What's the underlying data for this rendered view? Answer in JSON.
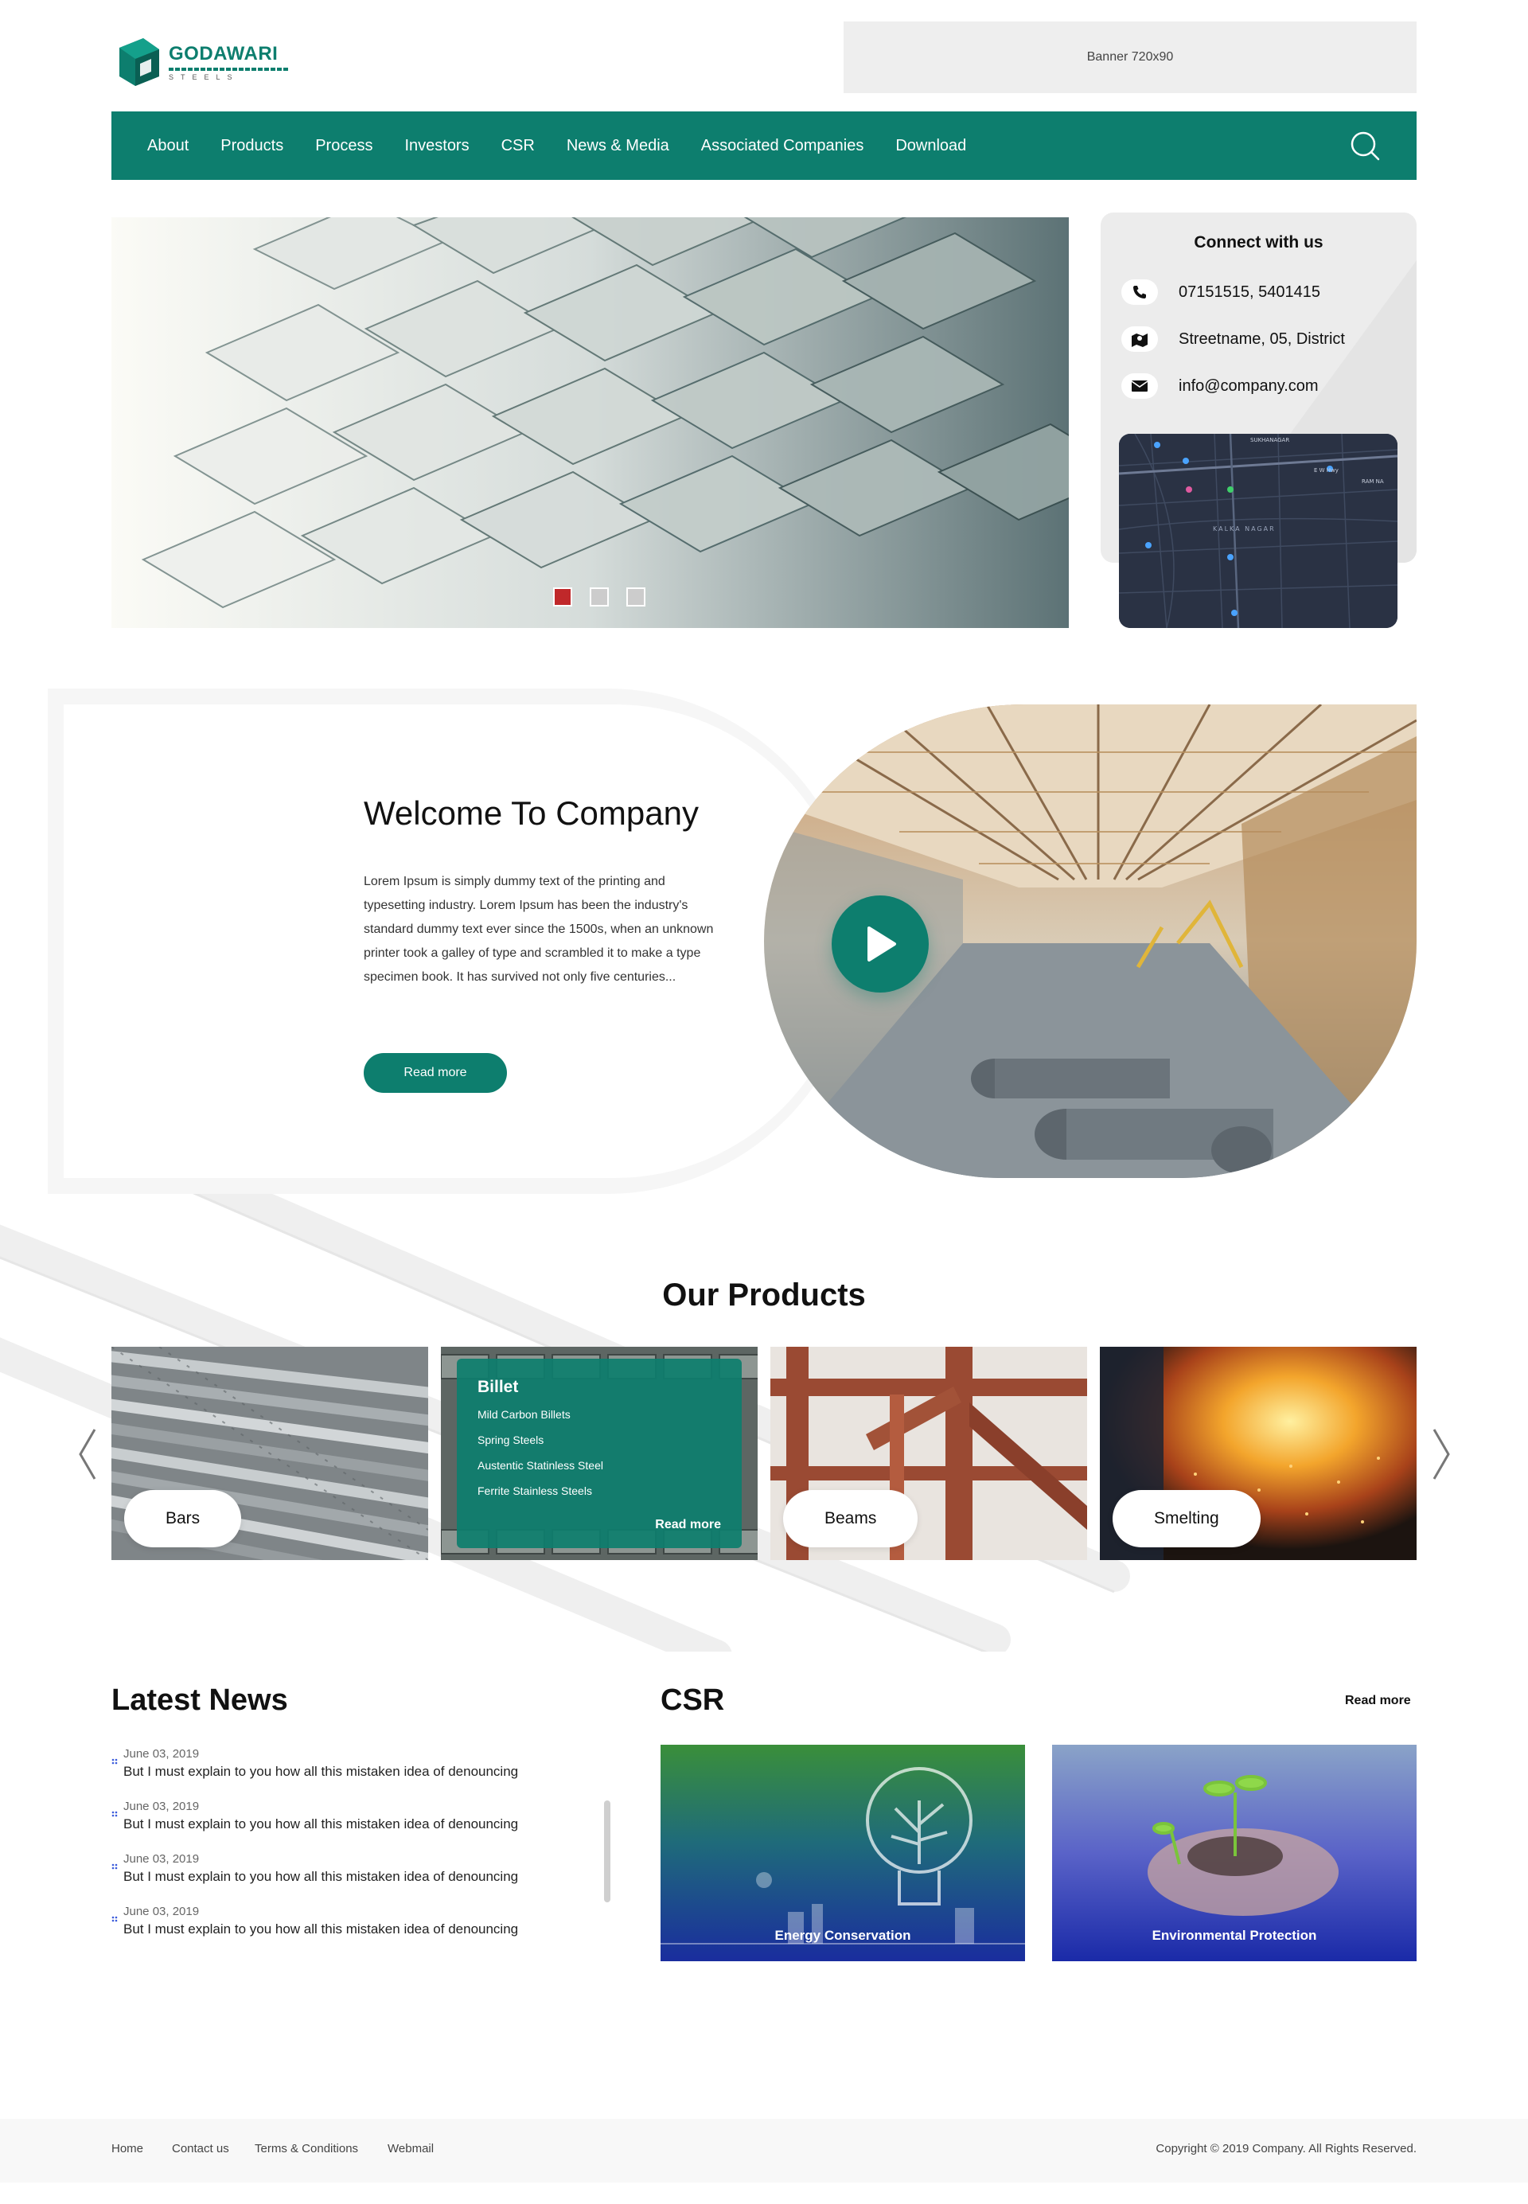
{
  "brand": {
    "name": "GODAWARI",
    "sub": "STEELS",
    "color": "#0d7e6e"
  },
  "banner": {
    "label": "Banner 720x90"
  },
  "nav": {
    "items": [
      "About",
      "Products",
      "Process",
      "Investors",
      "CSR",
      "News & Media",
      "Associated Companies",
      "Download"
    ],
    "search_icon": "search-icon"
  },
  "hero": {
    "slides": 3,
    "active_slide": 1
  },
  "connect": {
    "title": "Connect with us",
    "phone": "07151515, 5401415",
    "address": "Streetname, 05, District",
    "email": "info@company.com",
    "map_labels": [
      "SUKHANAGAR",
      "RAM NA",
      "KALKA NAGAR",
      "E W Hwy"
    ]
  },
  "welcome": {
    "title": "Welcome To Company",
    "text": "Lorem Ipsum is simply dummy text of the printing and typesetting industry. Lorem Ipsum has been the industry's standard dummy text ever since the 1500s, when an unknown printer took a galley of type and scrambled it to make a type specimen book. It has survived not only five centuries...",
    "button": "Read more"
  },
  "products": {
    "title": "Our Products",
    "cards": [
      {
        "label": "Bars"
      },
      {
        "label": "Billet",
        "items": [
          "Mild Carbon Billets",
          "Spring Steels",
          "Austentic Statinless Steel",
          "Ferrite Stainless Steels"
        ],
        "more": "Read more"
      },
      {
        "label": "Beams"
      },
      {
        "label": "Smelting"
      }
    ]
  },
  "news": {
    "title": "Latest News",
    "items": [
      {
        "date": "June 03, 2019",
        "text": "But I must explain to you how all this mistaken idea of denouncing"
      },
      {
        "date": "June 03, 2019",
        "text": "But I must explain to you how all this mistaken idea of denouncing"
      },
      {
        "date": "June 03, 2019",
        "text": "But I must explain to you how all this mistaken idea of denouncing"
      },
      {
        "date": "June 03, 2019",
        "text": "But I must explain to you how all this mistaken idea of denouncing"
      }
    ]
  },
  "csr": {
    "title": "CSR",
    "more": "Read more",
    "cards": [
      {
        "label": "Energy Conservation"
      },
      {
        "label": "Environmental Protection"
      }
    ]
  },
  "footer": {
    "links": [
      "Home",
      "Contact us",
      "Terms & Conditions",
      "Webmail"
    ],
    "copyright": "Copyright © 2019 Company. All Rights Reserved."
  }
}
